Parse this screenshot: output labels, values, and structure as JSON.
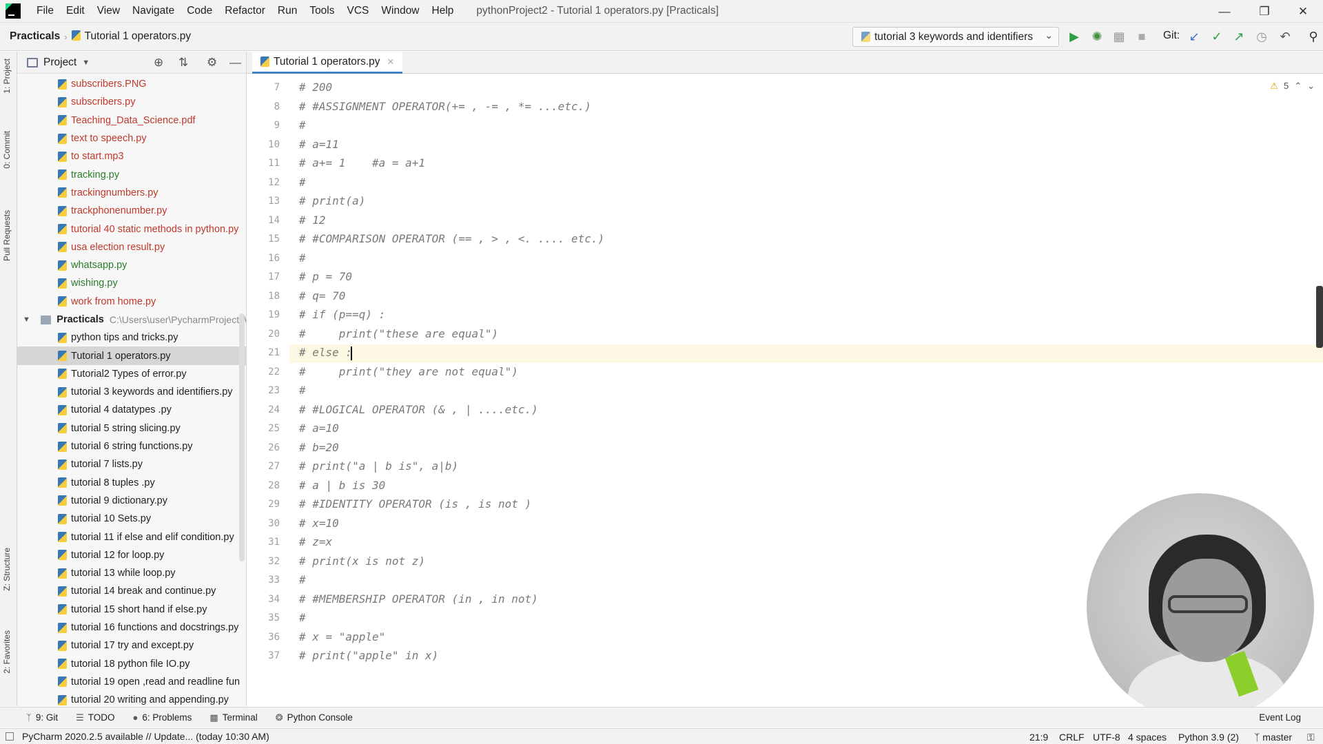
{
  "menubar": {
    "items": [
      "File",
      "Edit",
      "View",
      "Navigate",
      "Code",
      "Refactor",
      "Run",
      "Tools",
      "VCS",
      "Window",
      "Help"
    ],
    "title": "pythonProject2 - Tutorial 1 operators.py [Practicals]"
  },
  "navbar": {
    "project": "Practicals",
    "file": "Tutorial 1 operators.py",
    "run_config": "tutorial 3 keywords and identifiers",
    "git_label": "Git:"
  },
  "left_strip": {
    "labels": [
      "1: Project",
      "0: Commit",
      "Pull Requests",
      "Z: Structure",
      "2: Favorites"
    ]
  },
  "project_pane": {
    "title": "Project",
    "files_top": [
      {
        "name": "subscribers.PNG",
        "color": "red"
      },
      {
        "name": "subscribers.py",
        "color": "red"
      },
      {
        "name": "Teaching_Data_Science.pdf",
        "color": "red"
      },
      {
        "name": "text to speech.py",
        "color": "red"
      },
      {
        "name": "to start.mp3",
        "color": "red"
      },
      {
        "name": "tracking.py",
        "color": "green"
      },
      {
        "name": "trackingnumbers.py",
        "color": "red"
      },
      {
        "name": "trackphonenumber.py",
        "color": "red"
      },
      {
        "name": "tutorial 40 static methods in python.py",
        "color": "red"
      },
      {
        "name": "usa election result.py",
        "color": "red"
      },
      {
        "name": "whatsapp.py",
        "color": "green"
      },
      {
        "name": "wishing.py",
        "color": "green"
      },
      {
        "name": "work from home.py",
        "color": "red"
      }
    ],
    "folder": {
      "name": "Practicals",
      "path": "C:\\Users\\user\\PycharmProjects\\"
    },
    "files_folder": [
      "python tips and tricks.py",
      "Tutorial 1 operators.py",
      "Tutorial2 Types of error.py",
      "tutorial 3 keywords and identifiers.py",
      "tutorial 4 datatypes .py",
      "tutorial 5 string slicing.py",
      "tutorial 6 string functions.py",
      "tutorial 7 lists.py",
      "tutorial 8 tuples .py",
      "tutorial 9 dictionary.py",
      "tutorial 10 Sets.py",
      "tutorial 11 if else and elif condition.py",
      "tutorial 12 for loop.py",
      "tutorial 13 while loop.py",
      "tutorial 14 break and continue.py",
      "tutorial 15 short hand if else.py",
      "tutorial 16 functions and docstrings.py",
      "tutorial 17 try and except.py",
      "tutorial 18 python file IO.py",
      "tutorial 19 open ,read and readline fun",
      "tutorial 20 writing and appending.py"
    ],
    "selected_file": "Tutorial 1 operators.py"
  },
  "editor": {
    "tab": "Tutorial 1 operators.py",
    "inspection_count": "5",
    "current_line": 21,
    "lines": [
      {
        "no": "7",
        "text": "# 200"
      },
      {
        "no": "8",
        "text": "# #ASSIGNMENT OPERATOR(+= , -= , *= ...etc.)"
      },
      {
        "no": "9",
        "text": "#"
      },
      {
        "no": "10",
        "text": "# a=11"
      },
      {
        "no": "11",
        "text": "# a+= 1    #a = a+1"
      },
      {
        "no": "12",
        "text": "#"
      },
      {
        "no": "13",
        "text": "# print(a)"
      },
      {
        "no": "14",
        "text": "# 12"
      },
      {
        "no": "15",
        "text": "# #COMPARISON OPERATOR (== , > , <. .... etc.)"
      },
      {
        "no": "16",
        "text": "#"
      },
      {
        "no": "17",
        "text": "# p = 70"
      },
      {
        "no": "18",
        "text": "# q= 70"
      },
      {
        "no": "19",
        "text": "# if (p==q) :"
      },
      {
        "no": "20",
        "text": "#     print(\"these are equal\")"
      },
      {
        "no": "21",
        "text": "# else :"
      },
      {
        "no": "22",
        "text": "#     print(\"they are not equal\")"
      },
      {
        "no": "23",
        "text": "#"
      },
      {
        "no": "24",
        "text": "# #LOGICAL OPERATOR (& , | ....etc.)"
      },
      {
        "no": "25",
        "text": "# a=10"
      },
      {
        "no": "26",
        "text": "# b=20"
      },
      {
        "no": "27",
        "text": "# print(\"a | b is\", a|b)"
      },
      {
        "no": "28",
        "text": "# a | b is 30"
      },
      {
        "no": "29",
        "text": "# #IDENTITY OPERATOR (is , is not )"
      },
      {
        "no": "30",
        "text": "# x=10"
      },
      {
        "no": "31",
        "text": "# z=x"
      },
      {
        "no": "32",
        "text": "# print(x is not z)"
      },
      {
        "no": "33",
        "text": "#"
      },
      {
        "no": "34",
        "text": "# #MEMBERSHIP OPERATOR (in , in not)"
      },
      {
        "no": "35",
        "text": "#"
      },
      {
        "no": "36",
        "text": "# x = \"apple\""
      },
      {
        "no": "37",
        "text": "# print(\"apple\" in x)"
      }
    ]
  },
  "bottom_tools": {
    "items": [
      "9: Git",
      "TODO",
      "6: Problems",
      "Terminal",
      "Python Console"
    ],
    "event_log": "Event Log"
  },
  "status_bar": {
    "message": "PyCharm 2020.2.5 available // Update... (today 10:30 AM)",
    "position": "21:9",
    "line_sep": "CRLF",
    "encoding": "UTF-8",
    "indent": "4 spaces",
    "interpreter": "Python 3.9 (2)",
    "branch": "master"
  },
  "colors": {
    "file_red": "#c0392b",
    "file_green": "#2b7d2b",
    "accent": "#4083c9",
    "current_line_bg": "#fcf8e3"
  },
  "icons": {
    "toolbar": [
      "run-icon",
      "debug-icon",
      "coverage-icon",
      "stop-icon",
      "git-update-icon",
      "git-commit-icon",
      "git-push-icon",
      "history-icon",
      "rollback-icon",
      "search-icon"
    ],
    "project_header": [
      "locate-icon",
      "collapse-icon",
      "gear-icon",
      "minimize-icon"
    ]
  }
}
